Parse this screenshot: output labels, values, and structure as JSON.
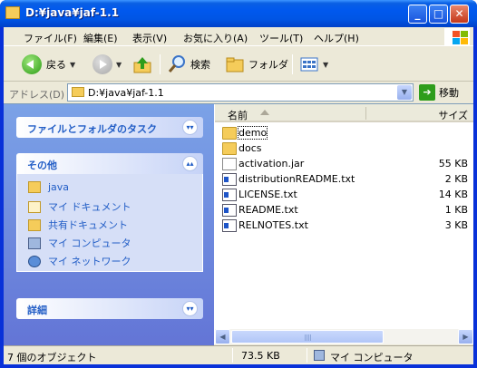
{
  "window": {
    "title": "D:¥java¥jaf-1.1",
    "minimize": "_",
    "maximize": "□",
    "close": "✕"
  },
  "menu": [
    {
      "label": "ファイル(F)"
    },
    {
      "label": "編集(E)"
    },
    {
      "label": "表示(V)"
    },
    {
      "label": "お気に入り(A)"
    },
    {
      "label": "ツール(T)"
    },
    {
      "label": "ヘルプ(H)"
    }
  ],
  "toolbar": {
    "back_label": "戻る",
    "search_label": "検索",
    "folders_label": "フォルダ"
  },
  "address": {
    "label": "アドレス(D)",
    "value": "D:¥java¥jaf-1.1",
    "go_label": "移動"
  },
  "taskpane": {
    "folder_tasks_title": "ファイルとフォルダのタスク",
    "other_places_title": "その他",
    "other_places": [
      {
        "label": "java",
        "icon": "folder-icon"
      },
      {
        "label": "マイ ドキュメント",
        "icon": "my-documents-icon"
      },
      {
        "label": "共有ドキュメント",
        "icon": "shared-documents-icon"
      },
      {
        "label": "マイ コンピュータ",
        "icon": "my-computer-icon"
      },
      {
        "label": "マイ ネットワーク",
        "icon": "my-network-icon"
      }
    ],
    "details_title": "詳細"
  },
  "filelist": {
    "col_name": "名前",
    "col_size": "サイズ",
    "items": [
      {
        "name": "demo",
        "size": "",
        "type": "folder"
      },
      {
        "name": "docs",
        "size": "",
        "type": "folder"
      },
      {
        "name": "activation.jar",
        "size": "55 KB",
        "type": "jar"
      },
      {
        "name": "distributionREADME.txt",
        "size": "2 KB",
        "type": "txt"
      },
      {
        "name": "LICENSE.txt",
        "size": "14 KB",
        "type": "txt"
      },
      {
        "name": "README.txt",
        "size": "1 KB",
        "type": "txt"
      },
      {
        "name": "RELNOTES.txt",
        "size": "3 KB",
        "type": "txt"
      }
    ]
  },
  "status": {
    "objects": "7 個のオブジェクト",
    "size": "73.5 KB",
    "location": "マイ コンピュータ"
  },
  "colors": {
    "title_blue": "#0055e5",
    "taskpane_blue": "#6f8fde",
    "link_blue": "#215dc6",
    "chrome": "#ece9d8"
  }
}
